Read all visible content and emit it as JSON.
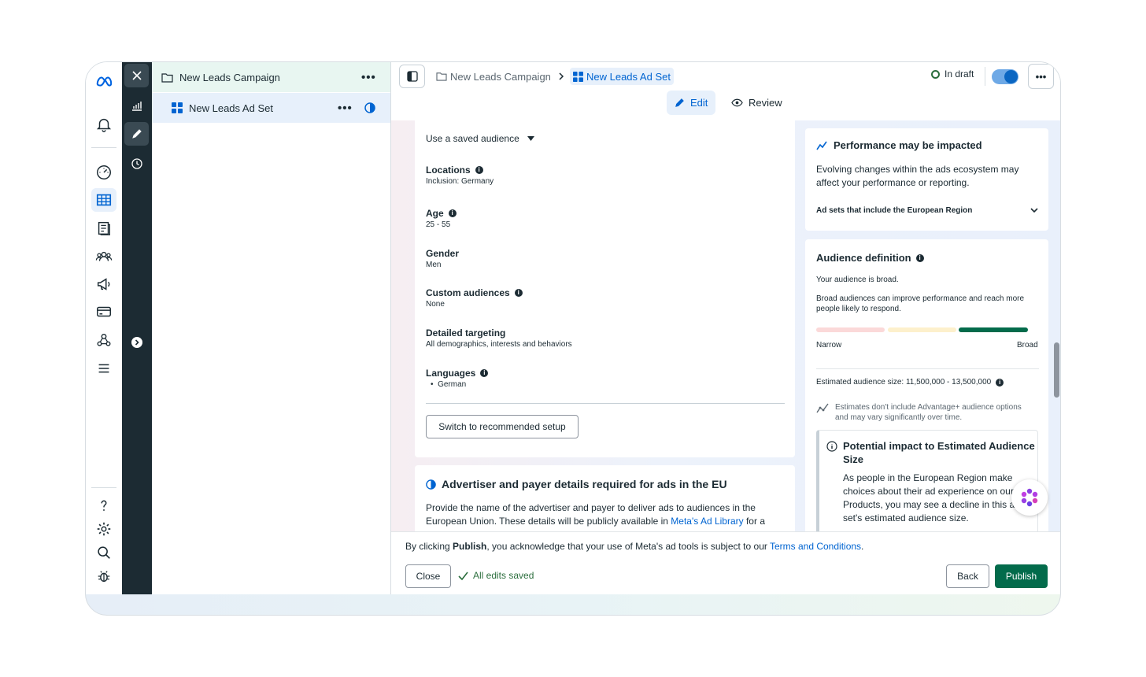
{
  "tree": {
    "campaign": "New Leads Campaign",
    "adset": "New Leads Ad Set"
  },
  "topbar": {
    "crumb_campaign": "New Leads Campaign",
    "crumb_adset": "New Leads Ad Set",
    "status": "In draft",
    "more": "•••",
    "tab_edit": "Edit",
    "tab_review": "Review"
  },
  "audience": {
    "saved_audience": "Use a saved audience",
    "locations_label": "Locations",
    "locations_value": "Inclusion: Germany",
    "age_label": "Age",
    "age_value": "25 - 55",
    "gender_label": "Gender",
    "gender_value": "Men",
    "custom_label": "Custom audiences",
    "custom_value": "None",
    "detailed_label": "Detailed targeting",
    "detailed_value": "All demographics, interests and behaviors",
    "languages_label": "Languages",
    "languages_value": "German",
    "switch_button": "Switch to recommended setup"
  },
  "eu_card": {
    "title": "Advertiser and payer details required for ads in the EU",
    "text_before": "Provide the name of the advertiser and payer to deliver ads to audiences in the European Union. These details will be publicly available in ",
    "link": "Meta's Ad Library",
    "text_after": " for a"
  },
  "performance": {
    "title": "Performance may be impacted",
    "text": "Evolving changes within the ads ecosystem may affect your performance or reporting.",
    "expander": "Ad sets that include the European Region"
  },
  "definition": {
    "title": "Audience definition",
    "broad": "Your audience is broad.",
    "broad_text": "Broad audiences can improve performance and reach more people likely to respond.",
    "narrow_label": "Narrow",
    "broad_label": "Broad",
    "meter_level": "broad",
    "estimated": "Estimated audience size: 11,500,000 - 13,500,000",
    "estimates_note_part1": "Estimates don't include Advantage+ audience options",
    "estimates_note_part2": " and may vary significantly over time.",
    "impact_title": "Potential impact to Estimated Audience Size",
    "impact_text": "As people in the European Region make choices about their ad experience on our Products, you may see a decline in this ad set's estimated audience size."
  },
  "footer": {
    "consent_before": "By clicking ",
    "consent_bold": "Publish",
    "consent_mid": ", you acknowledge that your use of Meta's ad tools is subject to our ",
    "consent_link": "Terms and Conditions",
    "consent_end": ".",
    "close": "Close",
    "saved": "All edits saved",
    "back": "Back",
    "publish": "Publish"
  },
  "colors": {
    "accent": "#0064d1",
    "publish": "#036b4b",
    "dark_strip": "#1c2b33",
    "saved_green": "#2b6e3d"
  },
  "icons": [
    "meta-logo-icon",
    "bell-icon",
    "gauge-icon",
    "table-icon",
    "pages-icon",
    "people-icon",
    "megaphone-icon",
    "card-icon",
    "network-icon",
    "menu-icon",
    "help-icon",
    "gear-icon",
    "search-icon",
    "bug-icon"
  ]
}
